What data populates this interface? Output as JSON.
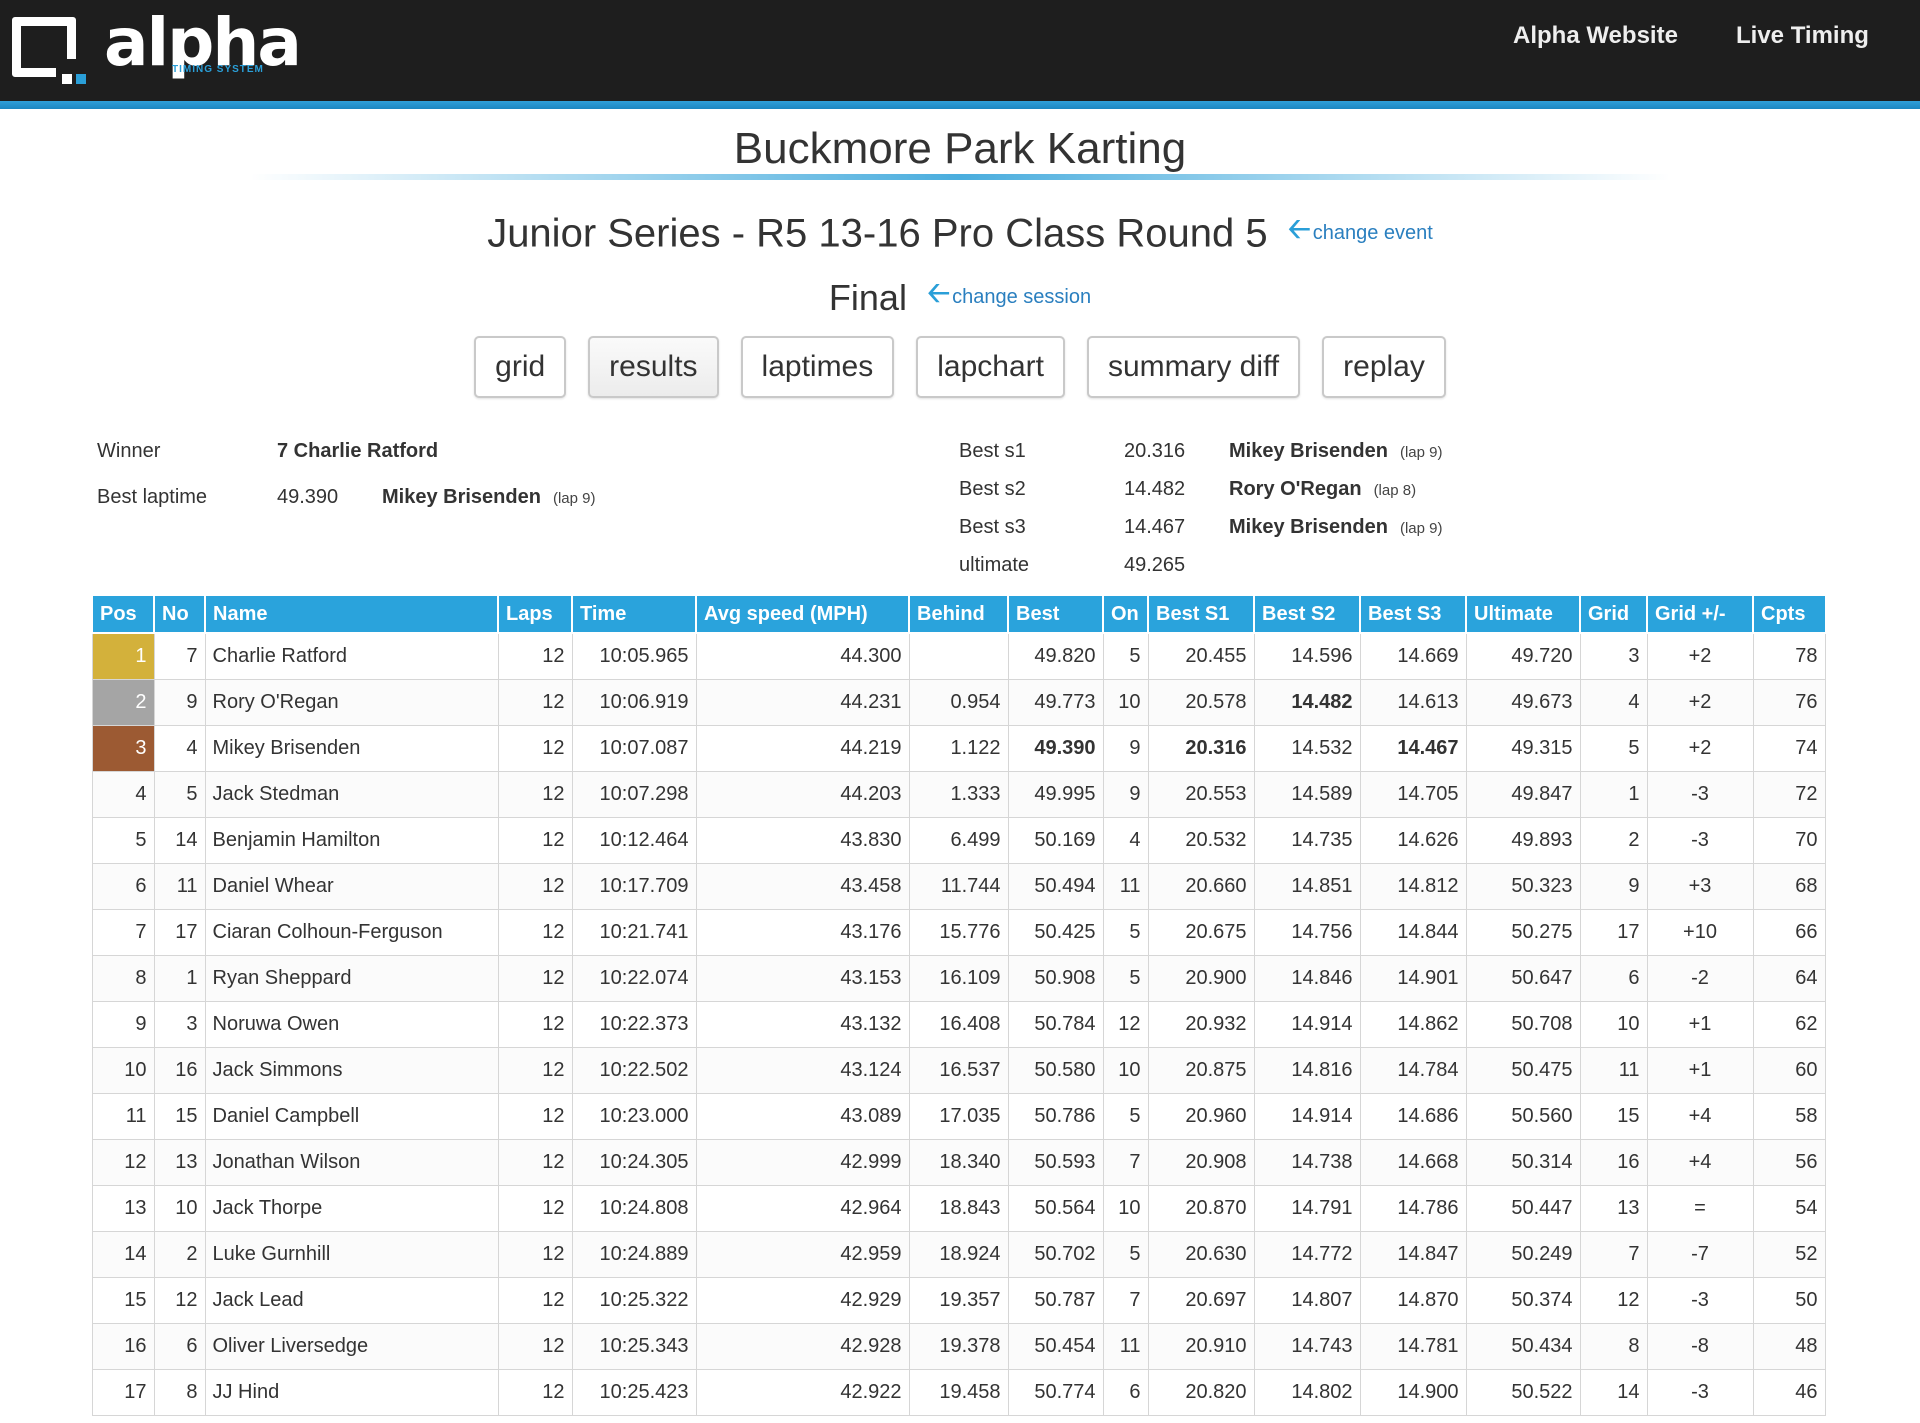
{
  "header": {
    "logo_word": "alpha",
    "logo_sub": "TIMING SYSTEM",
    "nav": [
      "Alpha Website",
      "Live Timing"
    ]
  },
  "venue": "Buckmore Park Karting",
  "event": {
    "title": "Junior Series - R5 13-16 Pro Class Round 5",
    "change_event": "change event",
    "session": "Final",
    "change_session": "change session"
  },
  "tabs": [
    "grid",
    "results",
    "laptimes",
    "lapchart",
    "summary diff",
    "replay"
  ],
  "active_tab": "results",
  "summary": {
    "winner_label": "Winner",
    "winner": "7 Charlie Ratford",
    "best_laptime_label": "Best laptime",
    "best_laptime": "49.390",
    "best_laptime_driver": "Mikey Brisenden",
    "best_laptime_lap": "(lap 9)",
    "bests": [
      {
        "label": "Best s1",
        "time": "20.316",
        "driver": "Mikey Brisenden",
        "lap": "(lap 9)"
      },
      {
        "label": "Best s2",
        "time": "14.482",
        "driver": "Rory O'Regan",
        "lap": "(lap 8)"
      },
      {
        "label": "Best s3",
        "time": "14.467",
        "driver": "Mikey Brisenden",
        "lap": "(lap 9)"
      },
      {
        "label": "ultimate",
        "time": "49.265",
        "driver": "",
        "lap": ""
      }
    ]
  },
  "colors": {
    "header_bg": "#1e1e1e",
    "accent": "#2aa3dc",
    "gold": "#d3b13b",
    "silver": "#a5a5a5",
    "bronze": "#9c5a33",
    "fastest": "#e020d8",
    "gain": "#2ea32e",
    "loss": "#f09a10"
  },
  "table": {
    "columns": [
      "Pos",
      "No",
      "Name",
      "Laps",
      "Time",
      "Avg speed (MPH)",
      "Behind",
      "Best",
      "On",
      "Best S1",
      "Best S2",
      "Best S3",
      "Ultimate",
      "Grid",
      "Grid +/-",
      "Cpts"
    ],
    "rows": [
      [
        "1",
        "7",
        "Charlie Ratford",
        "12",
        "10:05.965",
        "44.300",
        "",
        "49.820",
        "5",
        "20.455",
        "14.596",
        "14.669",
        "49.720",
        "3",
        "+2",
        "78"
      ],
      [
        "2",
        "9",
        "Rory O'Regan",
        "12",
        "10:06.919",
        "44.231",
        "0.954",
        "49.773",
        "10",
        "20.578",
        "14.482",
        "14.613",
        "49.673",
        "4",
        "+2",
        "76"
      ],
      [
        "3",
        "4",
        "Mikey Brisenden",
        "12",
        "10:07.087",
        "44.219",
        "1.122",
        "49.390",
        "9",
        "20.316",
        "14.532",
        "14.467",
        "49.315",
        "5",
        "+2",
        "74"
      ],
      [
        "4",
        "5",
        "Jack Stedman",
        "12",
        "10:07.298",
        "44.203",
        "1.333",
        "49.995",
        "9",
        "20.553",
        "14.589",
        "14.705",
        "49.847",
        "1",
        "-3",
        "72"
      ],
      [
        "5",
        "14",
        "Benjamin Hamilton",
        "12",
        "10:12.464",
        "43.830",
        "6.499",
        "50.169",
        "4",
        "20.532",
        "14.735",
        "14.626",
        "49.893",
        "2",
        "-3",
        "70"
      ],
      [
        "6",
        "11",
        "Daniel Whear",
        "12",
        "10:17.709",
        "43.458",
        "11.744",
        "50.494",
        "11",
        "20.660",
        "14.851",
        "14.812",
        "50.323",
        "9",
        "+3",
        "68"
      ],
      [
        "7",
        "17",
        "Ciaran Colhoun-Ferguson",
        "12",
        "10:21.741",
        "43.176",
        "15.776",
        "50.425",
        "5",
        "20.675",
        "14.756",
        "14.844",
        "50.275",
        "17",
        "+10",
        "66"
      ],
      [
        "8",
        "1",
        "Ryan Sheppard",
        "12",
        "10:22.074",
        "43.153",
        "16.109",
        "50.908",
        "5",
        "20.900",
        "14.846",
        "14.901",
        "50.647",
        "6",
        "-2",
        "64"
      ],
      [
        "9",
        "3",
        "Noruwa Owen",
        "12",
        "10:22.373",
        "43.132",
        "16.408",
        "50.784",
        "12",
        "20.932",
        "14.914",
        "14.862",
        "50.708",
        "10",
        "+1",
        "62"
      ],
      [
        "10",
        "16",
        "Jack Simmons",
        "12",
        "10:22.502",
        "43.124",
        "16.537",
        "50.580",
        "10",
        "20.875",
        "14.816",
        "14.784",
        "50.475",
        "11",
        "+1",
        "60"
      ],
      [
        "11",
        "15",
        "Daniel Campbell",
        "12",
        "10:23.000",
        "43.089",
        "17.035",
        "50.786",
        "5",
        "20.960",
        "14.914",
        "14.686",
        "50.560",
        "15",
        "+4",
        "58"
      ],
      [
        "12",
        "13",
        "Jonathan Wilson",
        "12",
        "10:24.305",
        "42.999",
        "18.340",
        "50.593",
        "7",
        "20.908",
        "14.738",
        "14.668",
        "50.314",
        "16",
        "+4",
        "56"
      ],
      [
        "13",
        "10",
        "Jack Thorpe",
        "12",
        "10:24.808",
        "42.964",
        "18.843",
        "50.564",
        "10",
        "20.870",
        "14.791",
        "14.786",
        "50.447",
        "13",
        "=",
        "54"
      ],
      [
        "14",
        "2",
        "Luke Gurnhill",
        "12",
        "10:24.889",
        "42.959",
        "18.924",
        "50.702",
        "5",
        "20.630",
        "14.772",
        "14.847",
        "50.249",
        "7",
        "-7",
        "52"
      ],
      [
        "15",
        "12",
        "Jack Lead",
        "12",
        "10:25.322",
        "42.929",
        "19.357",
        "50.787",
        "7",
        "20.697",
        "14.807",
        "14.870",
        "50.374",
        "12",
        "-3",
        "50"
      ],
      [
        "16",
        "6",
        "Oliver Liversedge",
        "12",
        "10:25.343",
        "42.928",
        "19.378",
        "50.454",
        "11",
        "20.910",
        "14.743",
        "14.781",
        "50.434",
        "8",
        "-8",
        "48"
      ],
      [
        "17",
        "8",
        "JJ Hind",
        "12",
        "10:25.423",
        "42.922",
        "19.458",
        "50.774",
        "6",
        "20.820",
        "14.802",
        "14.900",
        "50.522",
        "14",
        "-3",
        "46"
      ]
    ],
    "fastest_cells": [
      [
        1,
        10
      ],
      [
        2,
        7
      ],
      [
        2,
        9
      ],
      [
        2,
        11
      ]
    ]
  }
}
